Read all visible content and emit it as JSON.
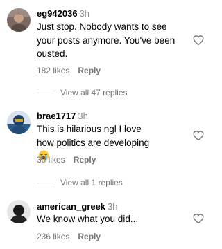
{
  "comments": [
    {
      "username": "eg942036",
      "time": "3h",
      "text": "Just stop. Nobody wants to see your posts anymore. You've been ousted.",
      "likes": "182 likes",
      "reply_label": "Reply",
      "view_replies": "View all 47 replies",
      "avatar_icon": "avatar-photo"
    },
    {
      "username": "brae1717",
      "time": "3h",
      "text": "This is hilarious ngl I love how politics are developing",
      "emoji": "loudly-crying-face-icon",
      "likes": "30 likes",
      "reply_label": "Reply",
      "view_replies": "View all 1 replies",
      "avatar_icon": "avatar-photo"
    },
    {
      "username": "american_greek",
      "time": "3h",
      "text": "We know what you did...",
      "likes": "236 likes",
      "reply_label": "Reply",
      "avatar_icon": "avatar-photo"
    }
  ],
  "colors": {
    "text_primary": "#000000",
    "text_secondary": "#737373",
    "timestamp": "#8e8e8e",
    "divider": "#c7c7c7",
    "heart_outline": "#737373"
  },
  "icons": {
    "like": "heart-outline-icon"
  }
}
